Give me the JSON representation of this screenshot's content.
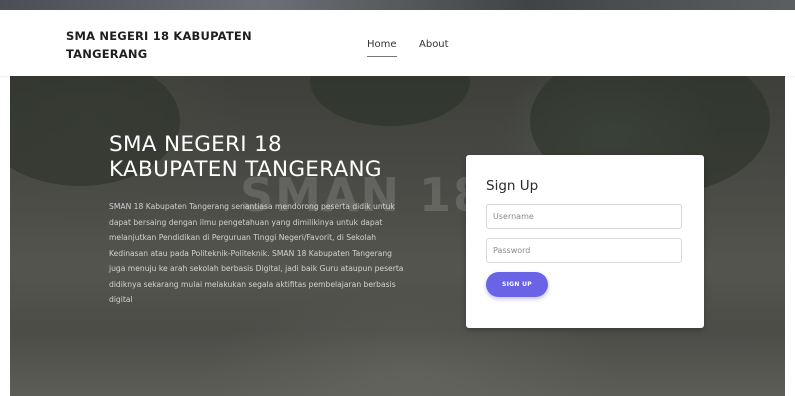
{
  "navbar": {
    "brand": "SMA NEGERI 18 KABUPATEN TANGERANG",
    "links": [
      {
        "label": "Home",
        "active": true
      },
      {
        "label": "About",
        "active": false
      }
    ]
  },
  "hero": {
    "title": "SMA NEGERI 18 KABUPATEN TANGERANG",
    "background_sign": "SMAN 18",
    "description": "SMAN 18 Kabupaten Tangerang senantiasa mendorong peserta didik untuk dapat bersaing dengan ilmu pengetahuan yang dimilikinya untuk dapat melanjutkan Pendidikan di Perguruan Tinggi Negeri/Favorit, di Sekolah Kedinasan atau pada Politeknik-Politeknik. SMAN 18 Kabupaten Tangerang juga menuju ke arah sekolah berbasis Digital, jadi baik Guru ataupun peserta didiknya sekarang mulai melakukan segala aktifitas pembelajaran berbasis digital"
  },
  "signup": {
    "title": "Sign Up",
    "username_placeholder": "Username",
    "password_placeholder": "Password",
    "button_label": "SIGN UP"
  },
  "colors": {
    "accent": "#6a63e6",
    "navbar_bg": "#ffffff",
    "card_bg": "#ffffff"
  }
}
